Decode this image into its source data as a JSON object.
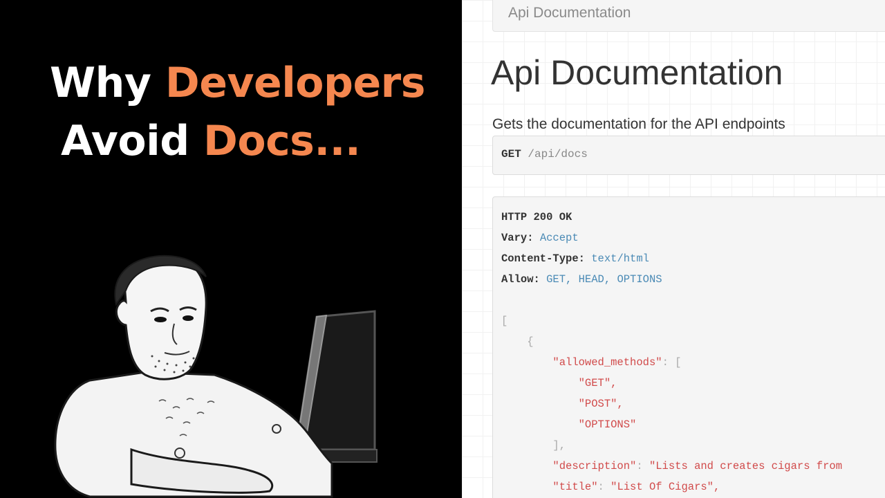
{
  "thumbnail": {
    "headline": {
      "line1_white": "Why ",
      "line1_accent": "Developers",
      "line2_white": "Avoid ",
      "line2_accent": "Docs..."
    },
    "colors": {
      "accent": "#f5874f",
      "left_background": "#000000",
      "headline_text": "#ffffff"
    }
  },
  "api_page": {
    "breadcrumb": "Api Documentation",
    "title": "Api Documentation",
    "description": "Gets the documentation for the API endpoints",
    "request": {
      "method": "GET",
      "path": "/api/docs"
    },
    "response": {
      "status": "HTTP 200 OK",
      "headers": [
        {
          "key": "Vary:",
          "value": "Accept"
        },
        {
          "key": "Content-Type:",
          "value": "text/html"
        },
        {
          "key": "Allow:",
          "value": "GET, HEAD, OPTIONS"
        }
      ],
      "body": {
        "open_bracket": "[",
        "open_brace": "{",
        "allowed_methods_key": "\"allowed_methods\"",
        "allowed_methods_open": "[",
        "methods": [
          "\"GET\",",
          "\"POST\",",
          "\"OPTIONS\""
        ],
        "allowed_methods_close": "],",
        "description_key": "\"description\"",
        "description_value": "\"Lists and creates cigars from",
        "title_key": "\"title\"",
        "title_value": "\"List Of Cigars\","
      }
    },
    "colors": {
      "header_value": "#4a8ab5",
      "json_string": "#d14a4a",
      "json_punctuation": "#aaaaaa"
    }
  }
}
